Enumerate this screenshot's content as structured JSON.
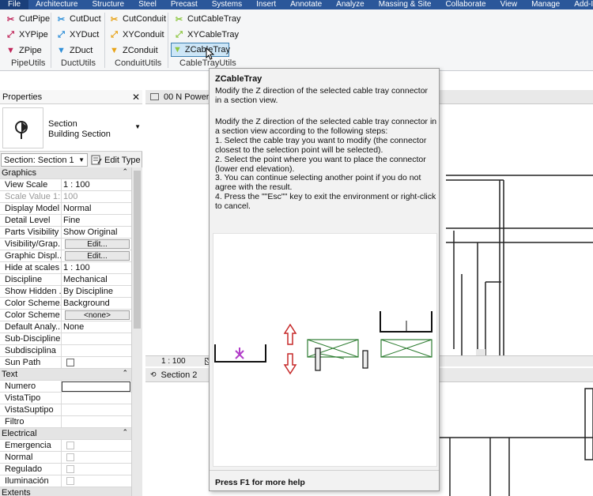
{
  "menu": [
    "File",
    "Architecture",
    "Structure",
    "Steel",
    "Precast",
    "Systems",
    "Insert",
    "Annotate",
    "Analyze",
    "Massing & Site",
    "Collaborate",
    "View",
    "Manage",
    "Add-Ins"
  ],
  "ribbon": {
    "pipe": {
      "label": "PipeUtils",
      "buttons": [
        "CutPipe",
        "XYPipe",
        "ZPipe"
      ]
    },
    "duct": {
      "label": "DuctUtils",
      "buttons": [
        "CutDuct",
        "XYDuct",
        "ZDuct"
      ]
    },
    "conduit": {
      "label": "ConduitUtils",
      "buttons": [
        "CutConduit",
        "XYConduit",
        "ZConduit"
      ]
    },
    "cabletray": {
      "label": "CableTrayUtils",
      "buttons": [
        "CutCableTray",
        "XYCableTray",
        "ZCableTray"
      ]
    },
    "colors": {
      "pipe": "#c0265a",
      "duct": "#2f8fd8",
      "conduit": "#e8a317",
      "cabletray": "#8cc63f"
    }
  },
  "properties": {
    "title": "Properties",
    "type_line1": "Section",
    "type_line2": "Building Section",
    "selector": "Section: Section 1",
    "edit_type": "Edit Type",
    "sections": {
      "graphics": "Graphics",
      "text": "Text",
      "electrical": "Electrical",
      "extents": "Extents"
    },
    "graphics_rows": [
      {
        "k": "View Scale",
        "v": "1 : 100"
      },
      {
        "k": "Scale Value    1:",
        "v": "100"
      },
      {
        "k": "Display Model",
        "v": "Normal"
      },
      {
        "k": "Detail Level",
        "v": "Fine"
      },
      {
        "k": "Parts Visibility",
        "v": "Show Original"
      },
      {
        "k": "Visibility/Grap...",
        "v": "Edit..."
      },
      {
        "k": "Graphic Displ...",
        "v": "Edit..."
      },
      {
        "k": "Hide at scales ...",
        "v": "1 : 100"
      },
      {
        "k": "Discipline",
        "v": "Mechanical"
      },
      {
        "k": "Show Hidden ...",
        "v": "By Discipline"
      },
      {
        "k": "Color Scheme...",
        "v": "Background"
      },
      {
        "k": "Color Scheme",
        "v": "<none>"
      },
      {
        "k": "Default Analy...",
        "v": "None"
      },
      {
        "k": "Sub-Discipline",
        "v": ""
      },
      {
        "k": "Subdisciplina",
        "v": ""
      },
      {
        "k": "Sun Path",
        "v": ""
      }
    ],
    "text_rows": [
      "Numero",
      "VistaTipo",
      "VistaSuptipo",
      "Filtro"
    ],
    "electrical_rows": [
      "Emergencia",
      "Normal",
      "Regulado",
      "Iluminación"
    ]
  },
  "views": {
    "top_title": "00 N Power",
    "scale": "1 : 100",
    "bottom_title": "Section 2"
  },
  "tooltip": {
    "title": "ZCableTray",
    "short": "Modify the Z direction of the selected cable tray connector in a section view.",
    "long": [
      "Modify the Z direction of the selected cable tray connector in",
      "a section view according to the following steps:",
      "1. Select the cable tray you want to modify (the connector",
      "closest to the selection point will be selected).",
      "2. Select the point where you want to place the connector",
      "(lower end elevation).",
      "3. You can continue selecting another point if you do not",
      "agree with the result.",
      "4. Press the \"\"Esc\"\" key to exit the environment or right-click",
      "to cancel."
    ],
    "footer": "Press F1 for more help"
  }
}
